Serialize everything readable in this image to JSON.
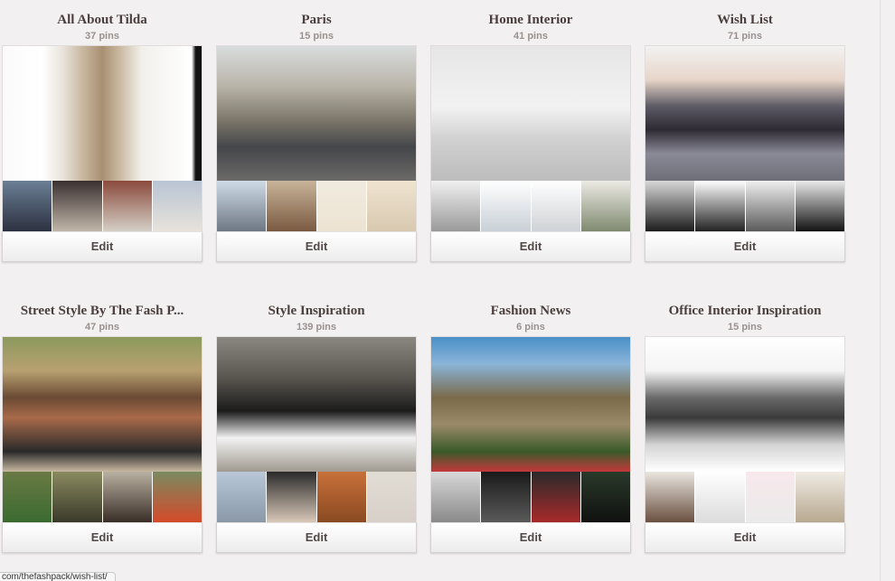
{
  "boards": [
    {
      "title": "All About Tilda",
      "count": "37 pins",
      "edit_label": "Edit",
      "cover_bg": "linear-gradient(90deg,#fafafa 0%,#ffffff 20%,#e9e4dc 30%,#c9b8a0 40%,#a88f72 50%,#c7b59c 58%,#f2f0ec 70%,#ffffff 95%,#111 97%)",
      "thumbs": [
        "linear-gradient(#6b7f96,#2c3140)",
        "linear-gradient(#3a3030,#c0b6a8)",
        "linear-gradient(#8a4a3c,#d4cfc6)",
        "linear-gradient(#b8c4d4,#e8e2da)"
      ]
    },
    {
      "title": "Paris",
      "count": "15 pins",
      "edit_label": "Edit",
      "cover_bg": "linear-gradient(180deg,#d9dcde 0%,#b9b4a8 30%,#7d776b 55%,#44464a 75%,#6b6a68 100%)",
      "thumbs": [
        "linear-gradient(#cfdbe6,#6d7884)",
        "linear-gradient(#c8b49a,#7a5a40)",
        "linear-gradient(#f1ebdf,#ece3d2)",
        "linear-gradient(#efe4d0,#d8c8b0)"
      ]
    },
    {
      "title": "Home Interior",
      "count": "41 pins",
      "edit_label": "Edit",
      "cover_bg": "linear-gradient(180deg,#e6e6e6 0%,#f2f2f2 45%,#d0d0d0 70%,#bcbcbc 100%)",
      "thumbs": [
        "linear-gradient(#f0f0f0,#9a9a9a)",
        "linear-gradient(#ffffff,#c8cfd6)",
        "linear-gradient(#ffffff,#cfd2d6)",
        "linear-gradient(#eceae4,#7f8a70)"
      ]
    },
    {
      "title": "Wish List",
      "count": "71 pins",
      "edit_label": "Edit",
      "cover_bg": "linear-gradient(180deg,#f2f2f2 0%,#e7d5c9 25%,#5c5a64 45%,#2e2a34 62%,#8a8a96 80%,#6e6e78 100%)",
      "thumbs": [
        "linear-gradient(#d8d8d8,#1c1c1c)",
        "linear-gradient(#ffffff,#222)",
        "linear-gradient(#f0f0f0,#5a5a5a)",
        "linear-gradient(#eaeaea,#121212)"
      ]
    },
    {
      "title": "Street Style By The Fash P...",
      "count": "47 pins",
      "edit_label": "Edit",
      "cover_bg": "linear-gradient(180deg,#8c9a5c 0%,#b8a070 25%,#6a4a34 45%,#a86a4a 60%,#2a2a2a 85%,#c8b8a0 100%)",
      "thumbs": [
        "linear-gradient(#6a7a44,#3a6a30)",
        "linear-gradient(#8a8a60,#3a3a2a)",
        "linear-gradient(#b8b0a0,#3a2e28)",
        "linear-gradient(#7a8a60,#d44a2a)"
      ]
    },
    {
      "title": "Style Inspiration",
      "count": "139 pins",
      "edit_label": "Edit",
      "cover_bg": "linear-gradient(180deg,#8a8880 0%,#5a5650 30%,#1c1c1c 55%,#f2f2f2 75%,#a09a90 100%)",
      "thumbs": [
        "linear-gradient(#b8c8d8,#8a98a8)",
        "linear-gradient(#2a2a2a,#d8c8b8)",
        "linear-gradient(#c8703a,#8a4a22)",
        "linear-gradient(#e0dcd4,#d8d0c8)"
      ]
    },
    {
      "title": "Fashion News",
      "count": "6 pins",
      "edit_label": "Edit",
      "cover_bg": "linear-gradient(180deg,#4a90c8 0%,#8ab4d8 20%,#7a6a4a 45%,#9a8a6a 65%,#3a5a2a 85%,#c4383a 100%)",
      "thumbs": [
        "linear-gradient(#d8d8d8,#8a8a8a)",
        "linear-gradient(#1a1a1a,#5a5a5a)",
        "linear-gradient(#2a2a2a,#a82a2a)",
        "linear-gradient(#2a3a2a,#101010)"
      ]
    },
    {
      "title": "Office Interior Inspiration",
      "count": "15 pins",
      "edit_label": "Edit",
      "cover_bg": "linear-gradient(180deg,#ffffff 0%,#f4f4f4 25%,#6a6a6a 45%,#3a3a3a 60%,#d4d4d4 80%,#ffffff 100%)",
      "thumbs": [
        "linear-gradient(#eae6e0,#6a5040)",
        "linear-gradient(#ffffff,#dcdcdc)",
        "linear-gradient(#f8e8ec,#eaeaea)",
        "linear-gradient(#f0ece4,#b8a890)"
      ]
    }
  ],
  "status_bar": {
    "url": "com/thefashpack/wish-list/"
  }
}
